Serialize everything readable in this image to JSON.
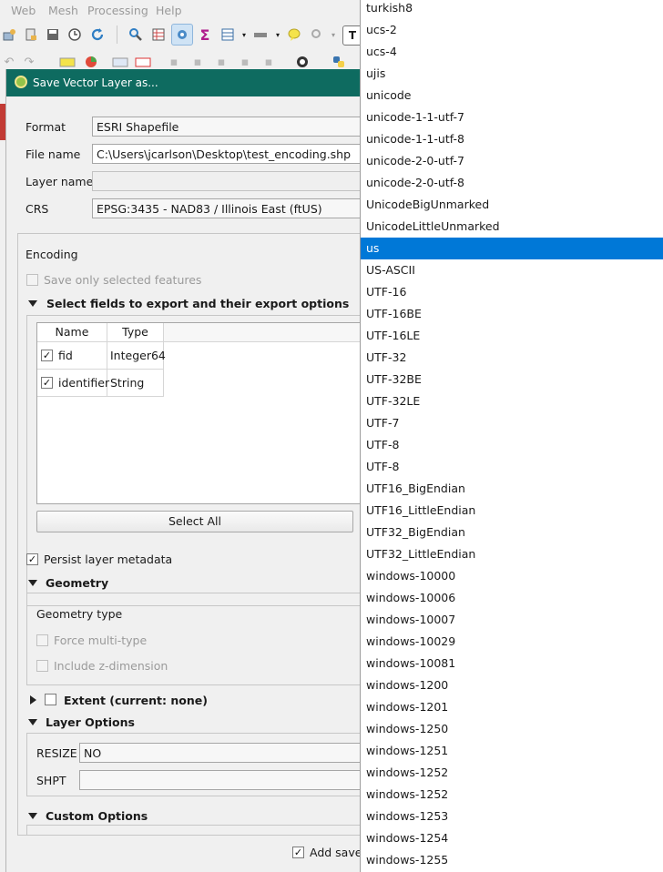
{
  "menubar": {
    "items": [
      {
        "label": "Web",
        "mnemonic": "W"
      },
      {
        "label": "Mesh",
        "mnemonic": "M"
      },
      {
        "label": "Processing",
        "mnemonic": "r"
      },
      {
        "label": "Help",
        "mnemonic": "H"
      }
    ]
  },
  "toolbar": {
    "row1_icons": [
      "layer-add-icon",
      "layer-edit-icon",
      "save-icon",
      "clock-icon",
      "refresh-icon",
      "identify-icon",
      "attribute-table-icon",
      "settings-gear-icon",
      "sigma-icon",
      "table-icon",
      "ruler-icon",
      "annotation-icon",
      "zoom-icon",
      "text-icon"
    ],
    "row2_icons": [
      "undo-icon",
      "redo-icon",
      "label-abc-icon",
      "diagram-icon",
      "label-style-icon",
      "label-abc-red-icon",
      "edit-icon",
      "digitize-icon",
      "node-icon",
      "move-icon",
      "split-icon",
      "merge-icon",
      "search-plugin-icon",
      "python-icon"
    ],
    "sigma": "Σ",
    "text_tool": "T"
  },
  "dialog": {
    "title": "Save Vector Layer as...",
    "format_label": "Format",
    "format_value": "ESRI Shapefile",
    "filename_label": "File name",
    "filename_value": "C:\\Users\\jcarlson\\Desktop\\test_encoding.shp",
    "layername_label": "Layer name",
    "layername_value": "",
    "crs_label": "CRS",
    "crs_value": "EPSG:3435 - NAD83 / Illinois East (ftUS)",
    "encoding_label": "Encoding",
    "save_selected_label": "Save only selected features",
    "fields_section_label": "Select fields to export and their export options",
    "table": {
      "headers": [
        "Name",
        "Type"
      ],
      "rows": [
        {
          "name": "fid",
          "type": "Integer64",
          "checked": true
        },
        {
          "name": "identifier",
          "type": "String",
          "checked": true
        }
      ]
    },
    "select_all_label": "Select All",
    "persist_metadata_label": "Persist layer metadata",
    "geometry_section_label": "Geometry",
    "geometry_type_label": "Geometry type",
    "force_multi_label": "Force multi-type",
    "include_z_label": "Include z-dimension",
    "extent_label": "Extent (current: none)",
    "layer_options_label": "Layer Options",
    "resize_label": "RESIZE",
    "resize_value": "NO",
    "shpt_label": "SHPT",
    "shpt_value": "",
    "custom_options_label": "Custom Options",
    "add_saved_label": "Add saved"
  },
  "encoding_dropdown": {
    "selected": "us",
    "options": [
      "turkish8",
      "ucs-2",
      "ucs-4",
      "ujis",
      "unicode",
      "unicode-1-1-utf-7",
      "unicode-1-1-utf-8",
      "unicode-2-0-utf-7",
      "unicode-2-0-utf-8",
      "UnicodeBigUnmarked",
      "UnicodeLittleUnmarked",
      "us",
      "US-ASCII",
      "UTF-16",
      "UTF-16BE",
      "UTF-16LE",
      "UTF-32",
      "UTF-32BE",
      "UTF-32LE",
      "UTF-7",
      "UTF-8",
      "UTF-8",
      "UTF16_BigEndian",
      "UTF16_LittleEndian",
      "UTF32_BigEndian",
      "UTF32_LittleEndian",
      "windows-10000",
      "windows-10006",
      "windows-10007",
      "windows-10029",
      "windows-10081",
      "windows-1200",
      "windows-1201",
      "windows-1250",
      "windows-1251",
      "windows-1252",
      "windows-1252",
      "windows-1253",
      "windows-1254",
      "windows-1255"
    ]
  },
  "colors": {
    "titlebar": "#0e6b60",
    "selection": "#0078d7",
    "alert_strip": "#c23b35"
  }
}
